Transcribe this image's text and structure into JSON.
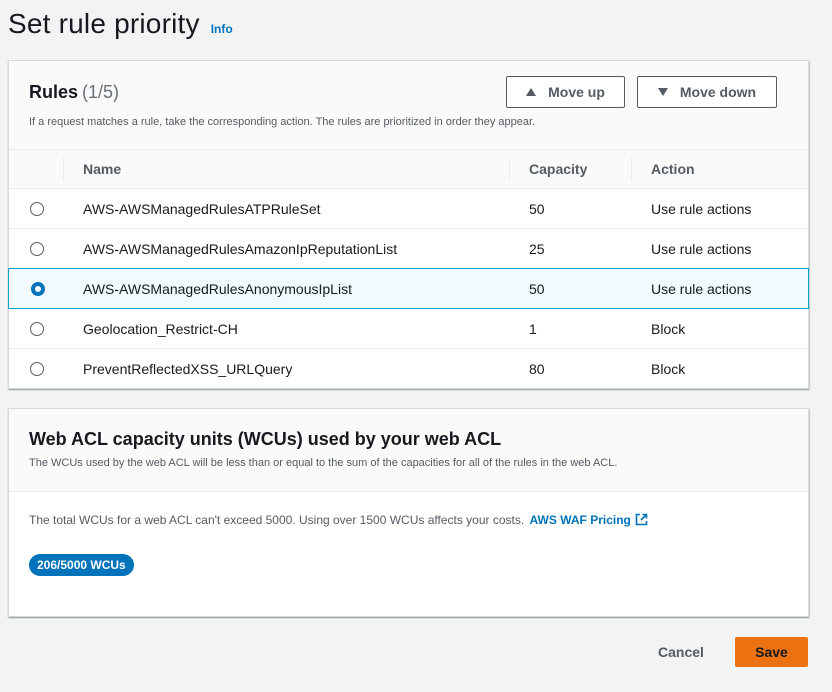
{
  "page": {
    "title": "Set rule priority",
    "info_label": "Info"
  },
  "rules_panel": {
    "heading": "Rules",
    "count": "(1/5)",
    "description": "If a request matches a rule, take the corresponding action. The rules are prioritized in order they appear.",
    "move_up_label": "Move up",
    "move_down_label": "Move down",
    "columns": {
      "name": "Name",
      "capacity": "Capacity",
      "action": "Action"
    },
    "rows": [
      {
        "name": "AWS-AWSManagedRulesATPRuleSet",
        "capacity": "50",
        "action": "Use rule actions",
        "selected": false
      },
      {
        "name": "AWS-AWSManagedRulesAmazonIpReputationList",
        "capacity": "25",
        "action": "Use rule actions",
        "selected": false
      },
      {
        "name": "AWS-AWSManagedRulesAnonymousIpList",
        "capacity": "50",
        "action": "Use rule actions",
        "selected": true
      },
      {
        "name": "Geolocation_Restrict-CH",
        "capacity": "1",
        "action": "Block",
        "selected": false
      },
      {
        "name": "PreventReflectedXSS_URLQuery",
        "capacity": "80",
        "action": "Block",
        "selected": false
      }
    ]
  },
  "wcu_panel": {
    "heading": "Web ACL capacity units (WCUs) used by your web ACL",
    "description": "The WCUs used by the web ACL will be less than or equal to the sum of the capacities for all of the rules in the web ACL.",
    "limit_text": "The total WCUs for a web ACL can't exceed 5000. Using over 1500 WCUs affects your costs.",
    "pricing_link": "AWS WAF Pricing",
    "usage_badge": "206/5000 WCUs"
  },
  "footer": {
    "cancel_label": "Cancel",
    "save_label": "Save"
  },
  "colors": {
    "accent": "#0073bb",
    "primary_button": "#ec7211",
    "selected_row_border": "#00a1c9"
  }
}
